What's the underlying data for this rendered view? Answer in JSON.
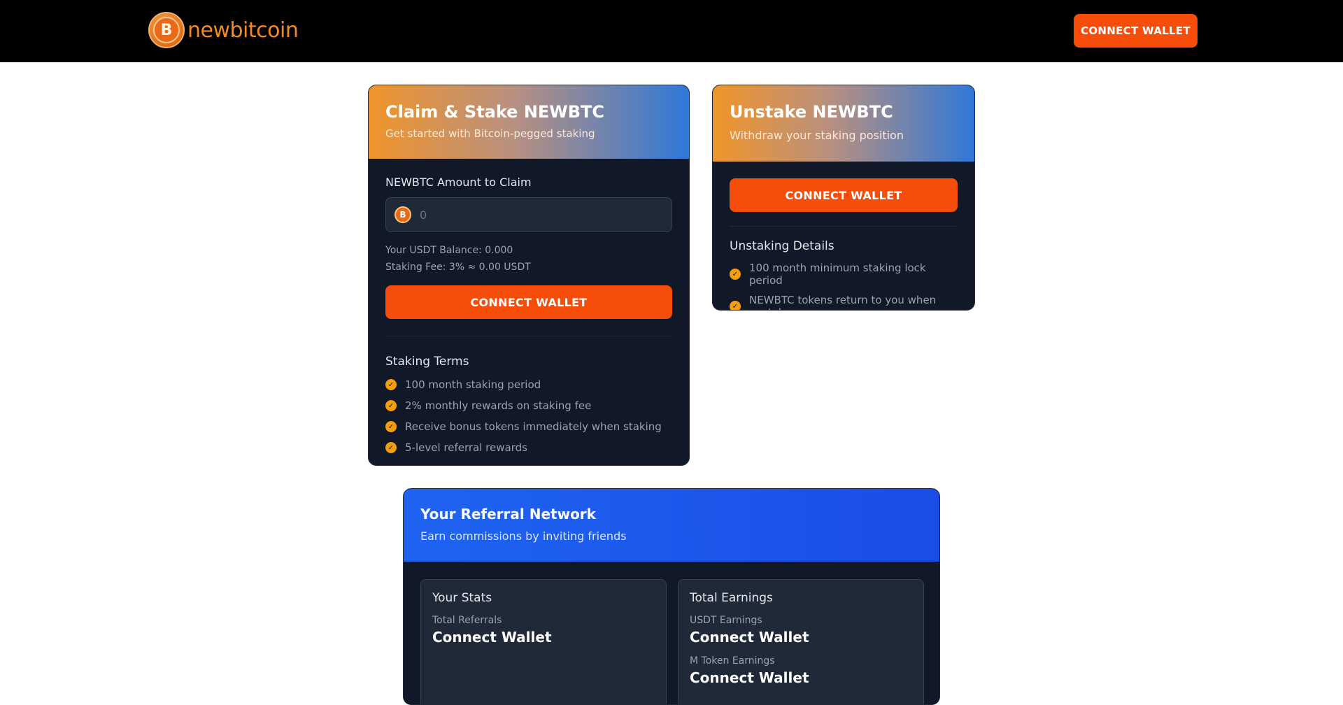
{
  "header": {
    "logo_letter": "B",
    "logo_text": "newbitcoin",
    "connect_label": "CONNECT WALLET"
  },
  "claim": {
    "title": "Claim & Stake NEWBTC",
    "subtitle": "Get started with Bitcoin-pegged staking",
    "amount_label": "NEWBTC Amount to Claim",
    "amount_placeholder": "0",
    "coin_letter": "B",
    "balance": "Your USDT Balance: 0.000",
    "fee": "Staking Fee: 3% ≈ 0.00 USDT",
    "connect_label": "CONNECT WALLET",
    "terms_title": "Staking Terms",
    "terms": [
      "100 month staking period",
      "2% monthly rewards on staking fee",
      "Receive bonus tokens immediately when staking",
      "5-level referral rewards"
    ]
  },
  "unstake": {
    "title": "Unstake NEWBTC",
    "subtitle": "Withdraw your staking position",
    "connect_label": "CONNECT WALLET",
    "details_title": "Unstaking Details",
    "details": [
      "100 month minimum staking lock period",
      "NEWBTC tokens return to you when unstake"
    ]
  },
  "referral": {
    "title": "Your Referral Network",
    "subtitle": "Earn commissions by inviting friends",
    "stats": {
      "title": "Your Stats",
      "total_referrals_label": "Total Referrals",
      "total_referrals_value": "Connect Wallet"
    },
    "earnings": {
      "title": "Total Earnings",
      "usdt_label": "USDT Earnings",
      "usdt_value": "Connect Wallet",
      "mtoken_label": "M Token Earnings",
      "mtoken_value": "Connect Wallet"
    }
  },
  "colors": {
    "accent": "#f64d0a",
    "card_bg": "#111827",
    "check": "#f59e0b",
    "referral_blue": "#1f64f0"
  }
}
